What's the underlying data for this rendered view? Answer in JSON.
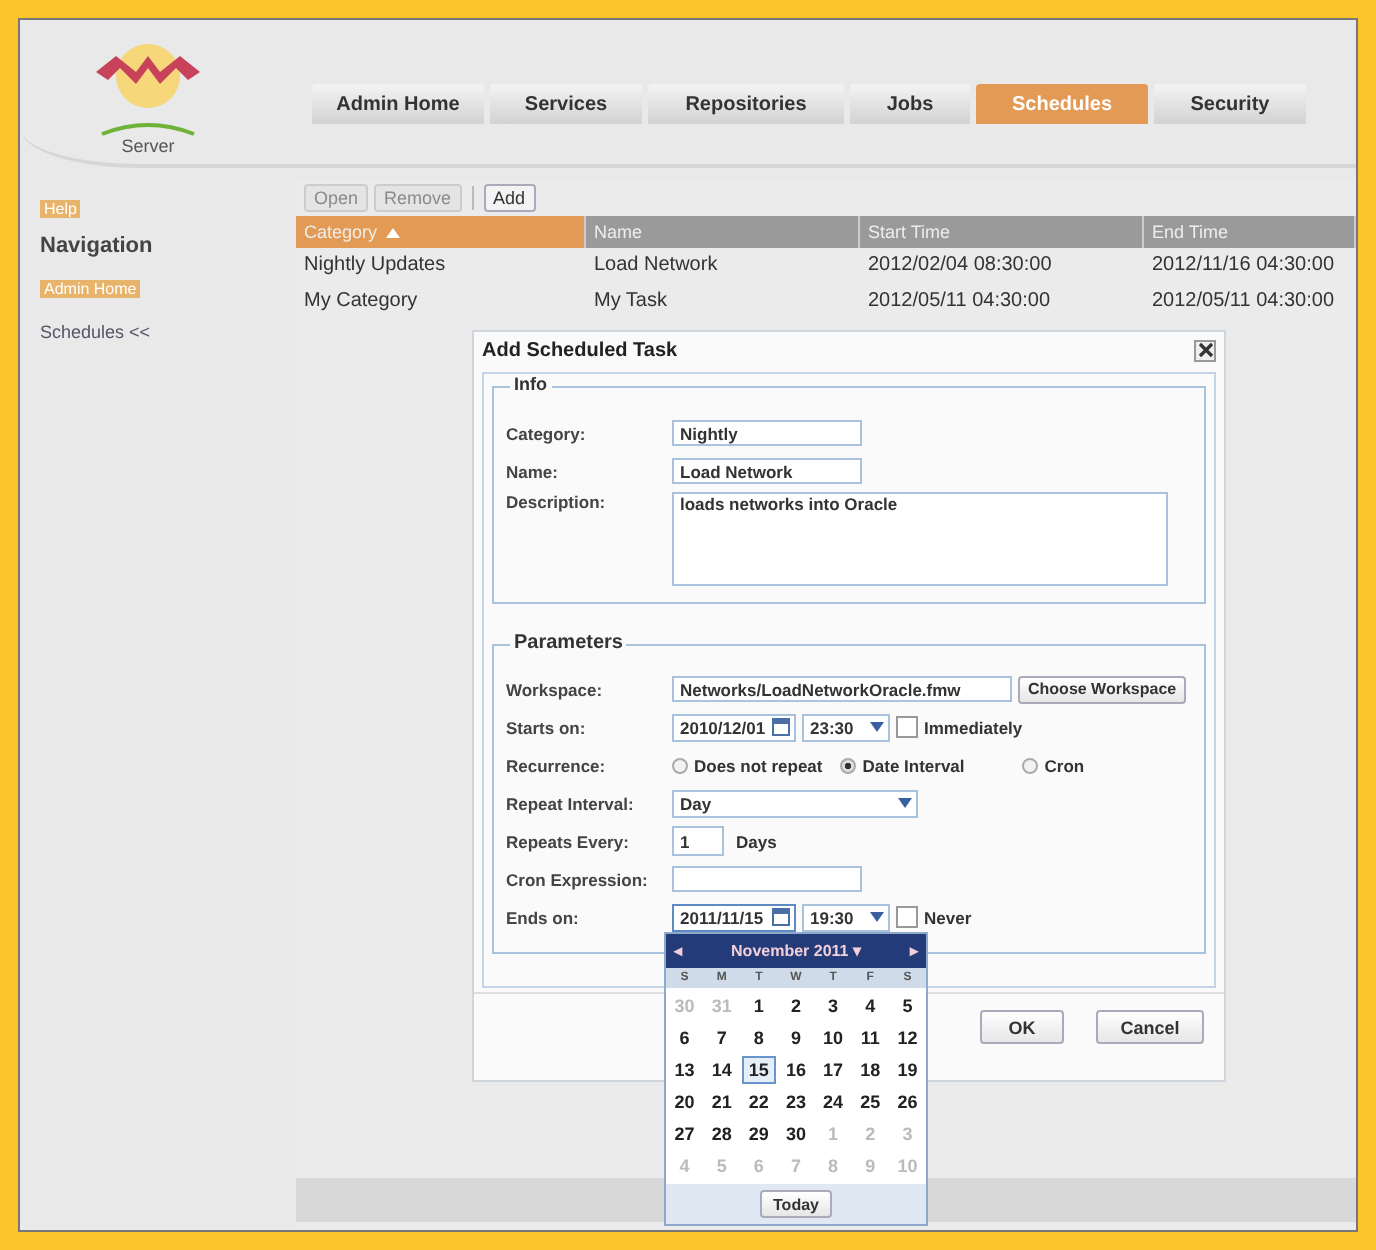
{
  "logo": {
    "caption": "Server"
  },
  "tabs": [
    {
      "label": "Admin Home",
      "selected": false
    },
    {
      "label": "Services",
      "selected": false
    },
    {
      "label": "Repositories",
      "selected": false
    },
    {
      "label": "Jobs",
      "selected": false
    },
    {
      "label": "Schedules",
      "selected": true
    },
    {
      "label": "Security",
      "selected": false
    }
  ],
  "sidebar": {
    "items": [
      {
        "label": "Help",
        "kind": "link"
      },
      {
        "label": "Navigation",
        "kind": "heading"
      },
      {
        "label": "Admin Home",
        "kind": "link"
      },
      {
        "label": "Schedules <<",
        "kind": "item"
      }
    ]
  },
  "toolbar": [
    {
      "label": "Open",
      "disabled": true
    },
    {
      "label": "Remove",
      "disabled": true
    },
    {
      "label": "Add",
      "disabled": false
    }
  ],
  "table": {
    "columns": [
      {
        "label": "Category",
        "sorted": true
      },
      {
        "label": "Name",
        "sorted": false
      },
      {
        "label": "Start Time",
        "sorted": false
      },
      {
        "label": "End Time",
        "sorted": false
      }
    ],
    "rows": [
      [
        "Nightly Updates",
        "Load Network",
        "2012/02/04 08:30:00",
        "2012/11/16 04:30:00"
      ],
      [
        "My Category",
        "My Task",
        "2012/05/11 04:30:00",
        "2012/05/11 04:30:00"
      ]
    ]
  },
  "dialog": {
    "title": "Add Scheduled Task",
    "info": {
      "legend": "Info",
      "category_label": "Category:",
      "category": "Nightly",
      "name_label": "Name:",
      "name": "Load Network",
      "description_label": "Description:",
      "description": "loads networks into Oracle"
    },
    "parameters": {
      "legend": "Parameters",
      "workspace_label": "Workspace:",
      "workspace": "Networks/LoadNetworkOracle.fmw",
      "choose_button": "Choose Workspace",
      "starts_label": "Starts on:",
      "start_date": "2010/12/01",
      "start_time": "23:30",
      "immediately": {
        "label": "Immediately",
        "checked": false
      },
      "recurrence_label": "Recurrence:",
      "recurrence": [
        {
          "label": "Does not repeat",
          "selected": false
        },
        {
          "label": "Date Interval",
          "selected": true
        },
        {
          "label": "Cron",
          "selected": false
        }
      ],
      "interval_label": "Repeat Interval:",
      "interval": "Day",
      "every_label": "Repeats Every:",
      "every": "1",
      "every_unit": "Days",
      "cron_label": "Cron Expression:",
      "ends_label": "Ends on:",
      "end_date": "2011/11/15",
      "end_time": "19:30",
      "never": {
        "label": "Never",
        "checked": false
      }
    },
    "buttons": [
      "OK",
      "Cancel"
    ]
  },
  "calendar": {
    "prev": "◂",
    "month": "November 2011",
    "month_caret": "▾",
    "next": "▸",
    "weekdays": [
      "S",
      "M",
      "T",
      "W",
      "T",
      "F",
      "S"
    ],
    "weeks": [
      [
        {
          "d": "30",
          "other": true,
          "selected": false
        },
        {
          "d": "31",
          "other": true,
          "selected": false
        },
        {
          "d": "1",
          "other": false,
          "selected": false
        },
        {
          "d": "2",
          "other": false,
          "selected": false
        },
        {
          "d": "3",
          "other": false,
          "selected": false
        },
        {
          "d": "4",
          "other": false,
          "selected": false
        },
        {
          "d": "5",
          "other": false,
          "selected": false
        }
      ],
      [
        {
          "d": "6",
          "other": false,
          "selected": false
        },
        {
          "d": "7",
          "other": false,
          "selected": false
        },
        {
          "d": "8",
          "other": false,
          "selected": false
        },
        {
          "d": "9",
          "other": false,
          "selected": false
        },
        {
          "d": "10",
          "other": false,
          "selected": false
        },
        {
          "d": "11",
          "other": false,
          "selected": false
        },
        {
          "d": "12",
          "other": false,
          "selected": false
        }
      ],
      [
        {
          "d": "13",
          "other": false,
          "selected": false
        },
        {
          "d": "14",
          "other": false,
          "selected": false
        },
        {
          "d": "15",
          "other": false,
          "selected": true
        },
        {
          "d": "16",
          "other": false,
          "selected": false
        },
        {
          "d": "17",
          "other": false,
          "selected": false
        },
        {
          "d": "18",
          "other": false,
          "selected": false
        },
        {
          "d": "19",
          "other": false,
          "selected": false
        }
      ],
      [
        {
          "d": "20",
          "other": false,
          "selected": false
        },
        {
          "d": "21",
          "other": false,
          "selected": false
        },
        {
          "d": "22",
          "other": false,
          "selected": false
        },
        {
          "d": "23",
          "other": false,
          "selected": false
        },
        {
          "d": "24",
          "other": false,
          "selected": false
        },
        {
          "d": "25",
          "other": false,
          "selected": false
        },
        {
          "d": "26",
          "other": false,
          "selected": false
        }
      ],
      [
        {
          "d": "27",
          "other": false,
          "selected": false
        },
        {
          "d": "28",
          "other": false,
          "selected": false
        },
        {
          "d": "29",
          "other": false,
          "selected": false
        },
        {
          "d": "30",
          "other": false,
          "selected": false
        },
        {
          "d": "1",
          "other": true,
          "selected": false
        },
        {
          "d": "2",
          "other": true,
          "selected": false
        },
        {
          "d": "3",
          "other": true,
          "selected": false
        }
      ],
      [
        {
          "d": "4",
          "other": true,
          "selected": false
        },
        {
          "d": "5",
          "other": true,
          "selected": false
        },
        {
          "d": "6",
          "other": true,
          "selected": false
        },
        {
          "d": "7",
          "other": true,
          "selected": false
        },
        {
          "d": "8",
          "other": true,
          "selected": false
        },
        {
          "d": "9",
          "other": true,
          "selected": false
        },
        {
          "d": "10",
          "other": true,
          "selected": false
        }
      ]
    ],
    "today": "Today"
  }
}
